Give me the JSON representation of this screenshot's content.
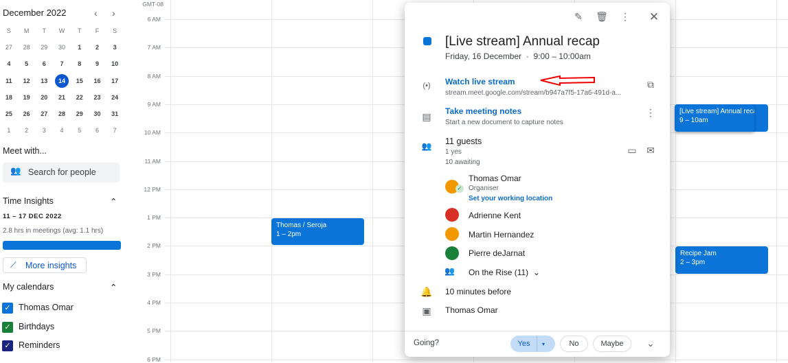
{
  "mini_calendar": {
    "month": "December 2022",
    "weekdays": [
      "S",
      "M",
      "T",
      "W",
      "T",
      "F",
      "S"
    ],
    "weeks": [
      [
        "27",
        "28",
        "29",
        "30",
        "1",
        "2",
        "3"
      ],
      [
        "4",
        "5",
        "6",
        "7",
        "8",
        "9",
        "10"
      ],
      [
        "11",
        "12",
        "13",
        "14",
        "15",
        "16",
        "17"
      ],
      [
        "18",
        "19",
        "20",
        "21",
        "22",
        "23",
        "24"
      ],
      [
        "25",
        "26",
        "27",
        "28",
        "29",
        "30",
        "31"
      ],
      [
        "1",
        "2",
        "3",
        "4",
        "5",
        "6",
        "7"
      ]
    ],
    "selected": "14"
  },
  "meet_with": {
    "title": "Meet with...",
    "placeholder": "Search for people"
  },
  "time_insights": {
    "title": "Time Insights",
    "range": "11 – 17 DEC 2022",
    "summary": "2.8 hrs in meetings (avg: 1.1 hrs)",
    "progress": 1.0,
    "more": "More insights"
  },
  "my_calendars": {
    "title": "My calendars",
    "items": [
      {
        "label": "Thomas Omar",
        "color": "#0b74d9"
      },
      {
        "label": "Birthdays",
        "color": "#188038"
      },
      {
        "label": "Reminders",
        "color": "#1a237e"
      }
    ]
  },
  "timezone": "GMT-08",
  "hours": [
    "6 AM",
    "7 AM",
    "8 AM",
    "9 AM",
    "10 AM",
    "11 AM",
    "12 PM",
    "1 PM",
    "2 PM",
    "3 PM",
    "4 PM",
    "5 PM",
    "6 PM"
  ],
  "events": [
    {
      "title": "Thomas / Seroja",
      "time": "1 – 2pm"
    },
    {
      "title": "[Live stream] Annual recap",
      "time": "9 – 10am"
    },
    {
      "title": "Recipe Jam",
      "time": "2 – 3pm"
    }
  ],
  "popup": {
    "title": "[Live stream] Annual recap",
    "date": "Friday, 16 December",
    "time": "9:00 – 10:00am",
    "color": "#0b74d9",
    "live_label": "Watch live stream",
    "live_url": "stream.meet.google.com/stream/b947a7f5-17a6-491d-a...",
    "notes_label": "Take meeting notes",
    "notes_sub": "Start a new document to capture notes",
    "guests": "11 guests",
    "yes": "1 yes",
    "awaiting": "10 awaiting",
    "organiser": {
      "name": "Thomas Omar",
      "role": "Organiser",
      "link": "Set your working location"
    },
    "attendees": [
      "Adrienne Kent",
      "Martin Hernandez",
      "Pierre deJarnat"
    ],
    "group": "On the Rise (11)",
    "reminder": "10 minutes before",
    "calendar": "Thomas Omar",
    "going": "Going?",
    "rsvp": {
      "yes": "Yes",
      "no": "No",
      "maybe": "Maybe"
    }
  }
}
